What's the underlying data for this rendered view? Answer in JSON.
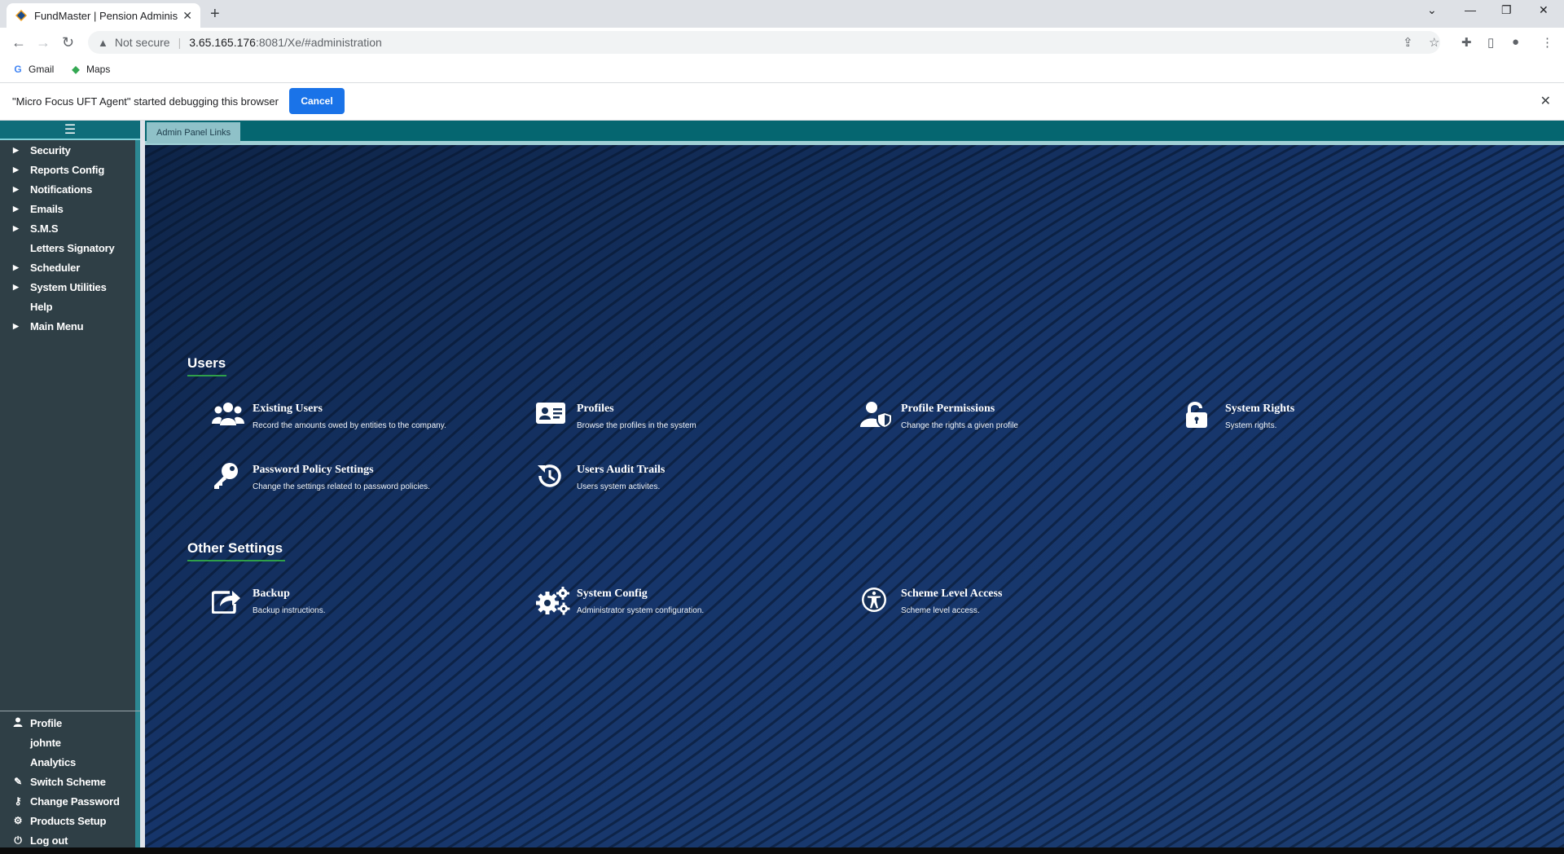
{
  "browser": {
    "tab_title": "FundMaster | Pension Administra",
    "url_warning": "Not secure",
    "url_host": "3.65.165.176",
    "url_path": ":8081/Xe/#administration",
    "bookmarks": [
      {
        "label": "Gmail",
        "icon": "google-icon"
      },
      {
        "label": "Maps",
        "icon": "maps-icon"
      }
    ],
    "infobar_message": "\"Micro Focus UFT Agent\" started debugging this browser",
    "infobar_cancel": "Cancel"
  },
  "sidebar": {
    "menu": [
      {
        "label": "Security",
        "expandable": true
      },
      {
        "label": "Reports Config",
        "expandable": true
      },
      {
        "label": "Notifications",
        "expandable": true
      },
      {
        "label": "Emails",
        "expandable": true
      },
      {
        "label": "S.M.S",
        "expandable": true
      },
      {
        "label": "Letters Signatory",
        "expandable": false
      },
      {
        "label": "Scheduler",
        "expandable": true
      },
      {
        "label": "System Utilities",
        "expandable": true
      },
      {
        "label": "Help",
        "expandable": false
      },
      {
        "label": "Main Menu",
        "expandable": true
      }
    ],
    "bottom": [
      {
        "label": "Profile",
        "icon": "user-icon"
      },
      {
        "label": "johnte",
        "icon": ""
      },
      {
        "label": "Analytics",
        "icon": ""
      },
      {
        "label": "Switch Scheme",
        "icon": "switch-icon"
      },
      {
        "label": "Change Password",
        "icon": "key-icon"
      },
      {
        "label": "Products Setup",
        "icon": "cogs-icon"
      },
      {
        "label": "Log out",
        "icon": "power-icon"
      }
    ]
  },
  "main": {
    "tab_label": "Admin Panel Links",
    "users_heading": "Users",
    "other_heading": "Other Settings",
    "users_links": [
      {
        "title": "Existing Users",
        "desc": "Record the amounts owed by entities to the company.",
        "icon": "users-icon"
      },
      {
        "title": "Profiles",
        "desc": "Browse the profiles in the system",
        "icon": "id-card-icon"
      },
      {
        "title": "Profile Permissions",
        "desc": "Change the rights a given profile",
        "icon": "user-shield-icon"
      },
      {
        "title": "System Rights",
        "desc": "System rights.",
        "icon": "unlock-icon"
      },
      {
        "title": "Password Policy Settings",
        "desc": "Change the settings related to password policies.",
        "icon": "key-icon"
      },
      {
        "title": "Users Audit Trails",
        "desc": "Users system activites.",
        "icon": "history-icon"
      }
    ],
    "other_links": [
      {
        "title": "Backup",
        "desc": "Backup instructions.",
        "icon": "share-icon"
      },
      {
        "title": "System Config",
        "desc": "Administrator system configuration.",
        "icon": "cogs-icon"
      },
      {
        "title": "Scheme Level Access",
        "desc": "Scheme level access.",
        "icon": "accessibility-icon"
      }
    ]
  }
}
